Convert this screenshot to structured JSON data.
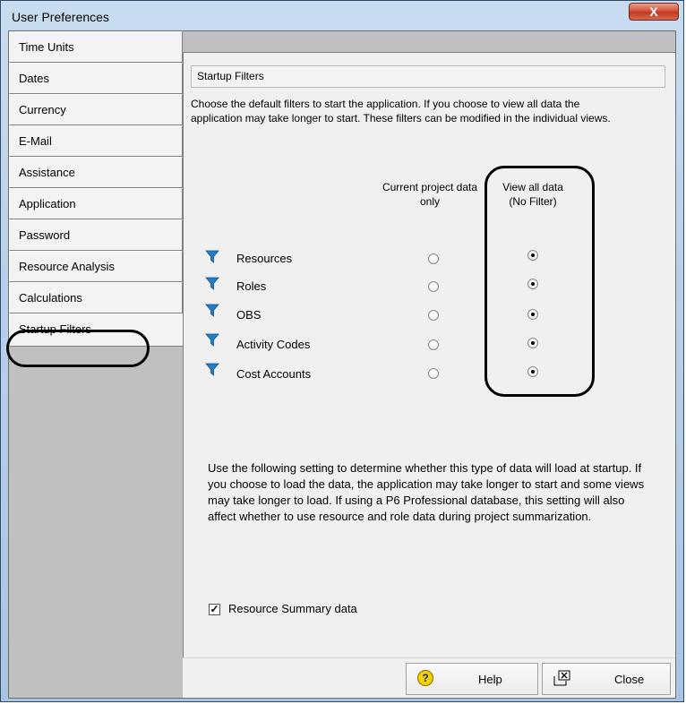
{
  "window": {
    "title": "User Preferences",
    "close_glyph": "X"
  },
  "tabs": [
    {
      "label": "Time Units"
    },
    {
      "label": "Dates"
    },
    {
      "label": "Currency"
    },
    {
      "label": "E-Mail"
    },
    {
      "label": "Assistance"
    },
    {
      "label": "Application"
    },
    {
      "label": "Password"
    },
    {
      "label": "Resource Analysis"
    },
    {
      "label": "Calculations"
    },
    {
      "label": "Startup Filters",
      "active": true
    }
  ],
  "panel": {
    "header": "Startup Filters",
    "description": "Choose the default filters to start the application.  If you choose to view all data the application may take longer to start.  These filters can be modified in the individual views.",
    "col1": "Current project data only",
    "col2": "View all data (No Filter)",
    "rows": [
      {
        "label": "Resources",
        "selected": "view_all"
      },
      {
        "label": "Roles",
        "selected": "view_all"
      },
      {
        "label": "OBS",
        "selected": "view_all"
      },
      {
        "label": "Activity Codes",
        "selected": "view_all"
      },
      {
        "label": "Cost Accounts",
        "selected": "view_all"
      }
    ],
    "summary_text": "Use the following setting to determine whether this type of data will load at startup. If you choose to load the data, the application may take longer to start and some views may take longer to load. If using a P6 Professional database, this setting will also affect whether to use resource and role data during project summarization.",
    "checkbox_label": "Resource Summary data",
    "checkbox_checked": true
  },
  "buttons": {
    "help": "Help",
    "close": "Close"
  },
  "icons": {
    "filter": "filter-funnel-icon",
    "help": "help-question-icon",
    "close": "close-window-icon"
  },
  "colors": {
    "filter_icon": "#1f7fc8",
    "annotation": "#000000"
  }
}
